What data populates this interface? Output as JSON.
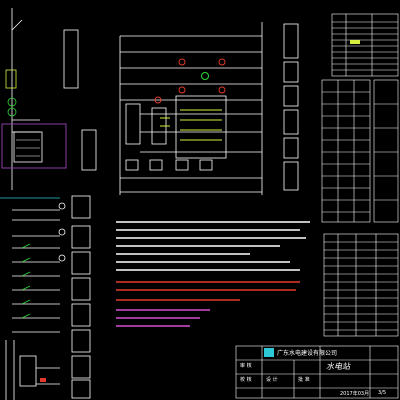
{
  "title_block": {
    "company": "广东水电建设有限公司",
    "date": "2017年03月",
    "sheet": "3/5",
    "project_abbrev": "水电站"
  },
  "title_block_cells": [
    "审  核",
    "设  计",
    "校  核",
    "批  准"
  ],
  "tables": {
    "right_top": {
      "rows": 11
    },
    "right_mid": {
      "rows": 12
    },
    "right_bottom": {
      "rows": 12
    }
  },
  "palette": {
    "line": "#ffffff",
    "cyan": "#2ec9d6",
    "yellow": "#d7ef3f",
    "red": "#e23b2e",
    "magenta": "#d64fd6",
    "green": "#32d93b",
    "purple": "#8a3ea6"
  }
}
